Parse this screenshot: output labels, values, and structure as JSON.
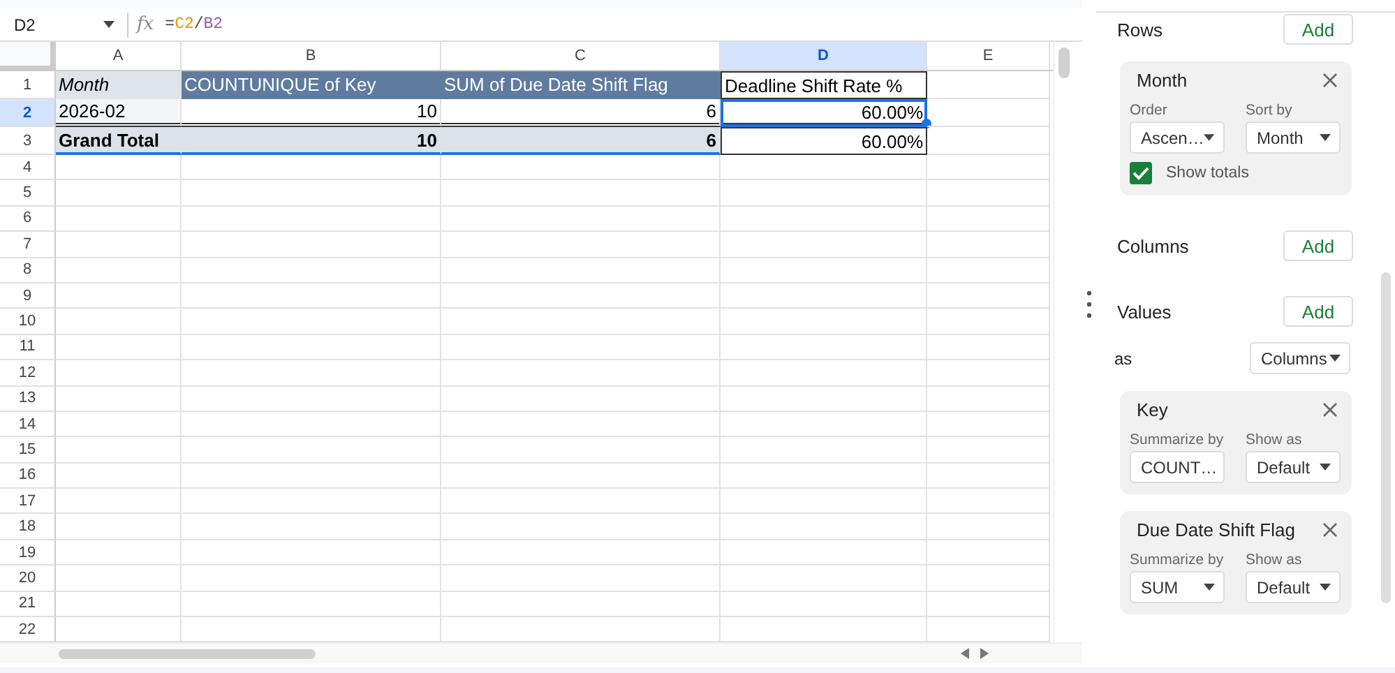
{
  "formula_bar": {
    "cell_ref": "D2",
    "fx": "fx",
    "formula": [
      {
        "text": "=",
        "color": "#444746"
      },
      {
        "text": "C2",
        "color": "#f09300"
      },
      {
        "text": "/",
        "color": "#444746"
      },
      {
        "text": "B2",
        "color": "#8e5cb5"
      }
    ]
  },
  "sheet": {
    "columns": [
      {
        "label": "A",
        "selected": false
      },
      {
        "label": "B",
        "selected": false
      },
      {
        "label": "C",
        "selected": false
      },
      {
        "label": "D",
        "selected": true
      },
      {
        "label": "E",
        "selected": false
      }
    ],
    "rows": [
      {
        "label": "1",
        "selected": false
      },
      {
        "label": "2",
        "selected": true
      },
      {
        "label": "3",
        "selected": false
      },
      {
        "label": "4",
        "selected": false
      },
      {
        "label": "5",
        "selected": false
      },
      {
        "label": "6",
        "selected": false
      },
      {
        "label": "7",
        "selected": false
      },
      {
        "label": "8",
        "selected": false
      },
      {
        "label": "9",
        "selected": false
      },
      {
        "label": "10",
        "selected": false
      },
      {
        "label": "11",
        "selected": false
      },
      {
        "label": "12",
        "selected": false
      },
      {
        "label": "13",
        "selected": false
      },
      {
        "label": "14",
        "selected": false
      },
      {
        "label": "15",
        "selected": false
      },
      {
        "label": "16",
        "selected": false
      },
      {
        "label": "17",
        "selected": false
      },
      {
        "label": "18",
        "selected": false
      },
      {
        "label": "19",
        "selected": false
      },
      {
        "label": "20",
        "selected": false
      },
      {
        "label": "21",
        "selected": false
      },
      {
        "label": "22",
        "selected": false
      }
    ],
    "pivot_rows": [
      {
        "kind": "header",
        "cells": [
          {
            "text": "Month",
            "kind": "pivot",
            "selected": false
          },
          {
            "text": "COUNTUNIQUE of Key",
            "kind": "pivot",
            "selected": false
          },
          {
            "text": "SUM of Due Date Shift Flag",
            "kind": "pivot",
            "selected": false
          },
          {
            "text": "Deadline Shift Rate %",
            "kind": "calc",
            "selected": false
          }
        ]
      },
      {
        "kind": "data",
        "cells": [
          {
            "text": "2026-02",
            "kind": "pivot",
            "selected": false
          },
          {
            "text": "10",
            "kind": "pivot",
            "selected": false
          },
          {
            "text": "6",
            "kind": "pivot",
            "selected": false
          },
          {
            "text": "60.00%",
            "kind": "calc",
            "selected": true
          }
        ]
      },
      {
        "kind": "total",
        "cells": [
          {
            "text": "Grand Total",
            "kind": "pivot",
            "selected": false
          },
          {
            "text": "10",
            "kind": "pivot",
            "selected": false
          },
          {
            "text": "6",
            "kind": "pivot",
            "selected": false
          },
          {
            "text": "60.00%",
            "kind": "calc",
            "selected": false
          }
        ]
      }
    ]
  },
  "rows_section": {
    "title": "Rows",
    "add_button": "Add",
    "fields": [
      {
        "name": "Month",
        "order_label": "Order",
        "order": "Ascen…",
        "sort_label": "Sort by",
        "sort": "Month",
        "show_totals_label": "Show totals",
        "show_totals": true
      }
    ]
  },
  "columns_section": {
    "title": "Columns",
    "add_button": "Add"
  },
  "values_section": {
    "title": "Values",
    "add_button": "Add",
    "as_label": "as",
    "as_value": "Columns",
    "fields": [
      {
        "name": "Key",
        "summarize_label": "Summarize by",
        "summarize": "COUNT…",
        "show_as_label": "Show as",
        "show_as": "Default"
      },
      {
        "name": "Due Date Shift Flag",
        "summarize_label": "Summarize by",
        "summarize": "SUM",
        "show_as_label": "Show as",
        "show_as": "Default"
      }
    ]
  }
}
